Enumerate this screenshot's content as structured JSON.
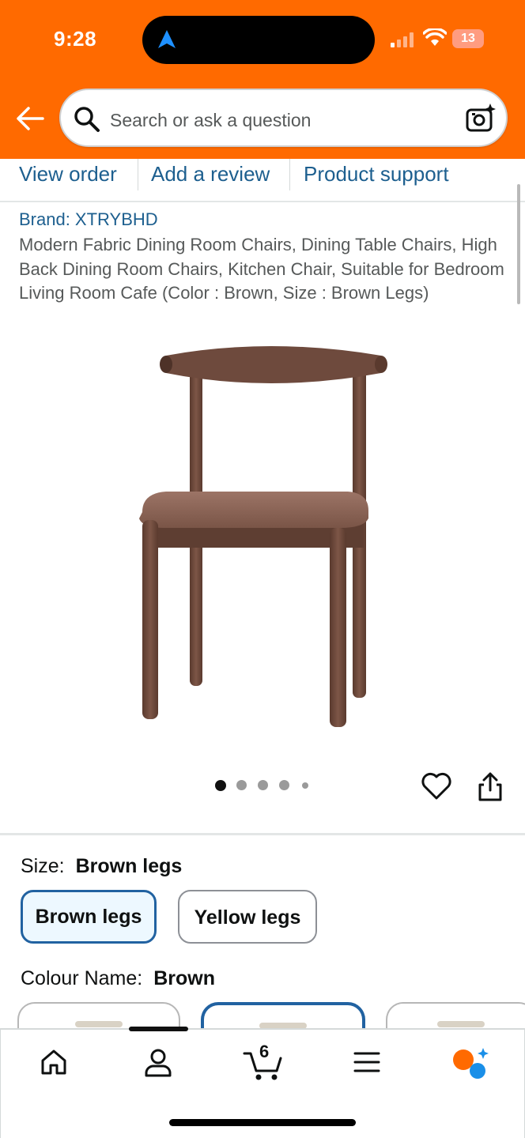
{
  "status_bar": {
    "time": "9:28",
    "battery": "13"
  },
  "search": {
    "placeholder": "Search or ask a question"
  },
  "tabs": [
    "View order",
    "Add a review",
    "Product support"
  ],
  "product": {
    "brand": "Brand: XTRYBHD",
    "title": "Modern Fabric Dining Room Chairs, Dining Table Chairs, High Back Dining Room Chairs, Kitchen Chair, Suitable for Bedroom Living Room Cafe (Color : Brown, Size : Brown Legs)",
    "image_count": 5,
    "active_image": 1
  },
  "size": {
    "label": "Size:",
    "selected": "Brown legs",
    "options": [
      "Brown legs",
      "Yellow legs"
    ]
  },
  "colour": {
    "label": "Colour Name:",
    "selected": "Brown"
  },
  "nav": {
    "cart_count": "6",
    "items": [
      "home-icon",
      "account-icon",
      "cart-icon",
      "menu-icon",
      "rufus-icon"
    ]
  },
  "colors": {
    "header": "#ff6a00",
    "link": "#1d5f8f",
    "selected_border": "#2162a1"
  }
}
